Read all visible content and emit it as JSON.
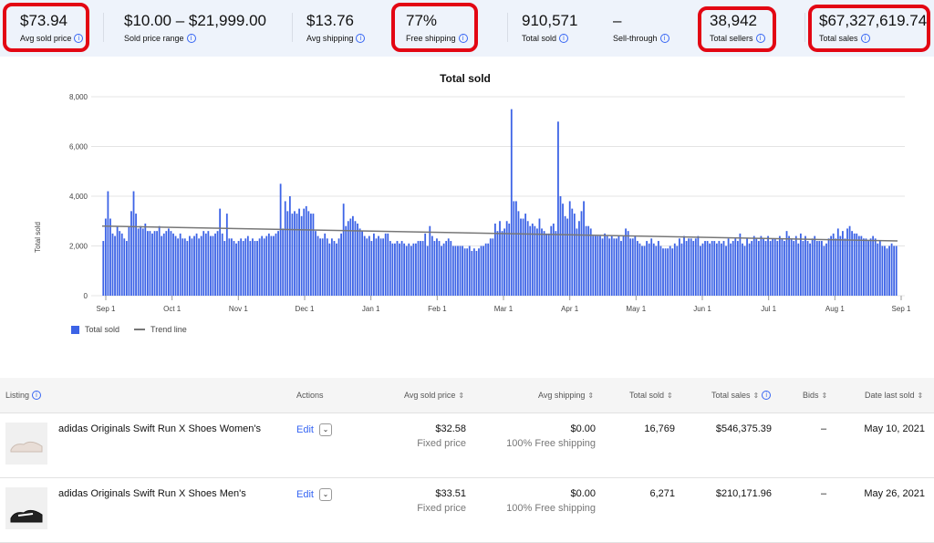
{
  "metrics": [
    {
      "value": "$73.94",
      "label": "Avg sold price",
      "highlight": true
    },
    {
      "value": "$10.00 – $21,999.00",
      "label": "Sold price range",
      "highlight": false
    },
    {
      "value": "$13.76",
      "label": "Avg shipping",
      "highlight": false
    },
    {
      "value": "77%",
      "label": "Free shipping",
      "highlight": true
    },
    {
      "value": "910,571",
      "label": "Total sold",
      "highlight": false
    },
    {
      "value": "–",
      "label": "Sell-through",
      "highlight": false
    },
    {
      "value": "38,942",
      "label": "Total sellers",
      "highlight": true
    },
    {
      "value": "$67,327,619.74",
      "label": "Total sales",
      "highlight": true
    }
  ],
  "chart_data": {
    "type": "bar",
    "title": "Total sold",
    "ylabel": "Total sold",
    "ylim": [
      0,
      8000
    ],
    "yticks": [
      "0",
      "2,000",
      "4,000",
      "6,000",
      "8,000"
    ],
    "xticks": [
      "Sep 1",
      "Oct 1",
      "Nov 1",
      "Dec 1",
      "Jan 1",
      "Feb 1",
      "Mar 1",
      "Apr 1",
      "May 1",
      "Jun 1",
      "Jul 1",
      "Aug 1",
      "Sep 1"
    ],
    "series": [
      {
        "name": "Total sold",
        "color": "#3c63e6"
      },
      {
        "name": "Trend line",
        "color": "#777777",
        "trend": [
          2800,
          2200
        ]
      }
    ],
    "grid": true,
    "legend": "bottom-left",
    "values": [
      2200,
      3100,
      4200,
      3100,
      2500,
      2400,
      2800,
      2600,
      2500,
      2300,
      2200,
      2800,
      3400,
      4200,
      3300,
      2700,
      2800,
      2700,
      2900,
      2600,
      2600,
      2500,
      2600,
      2600,
      2800,
      2400,
      2500,
      2600,
      2700,
      2600,
      2500,
      2400,
      2300,
      2500,
      2300,
      2300,
      2200,
      2400,
      2300,
      2400,
      2500,
      2300,
      2400,
      2600,
      2500,
      2600,
      2400,
      2400,
      2500,
      2600,
      3500,
      2500,
      2200,
      3300,
      2300,
      2300,
      2200,
      2100,
      2200,
      2300,
      2200,
      2300,
      2400,
      2200,
      2300,
      2200,
      2200,
      2300,
      2400,
      2300,
      2400,
      2500,
      2400,
      2400,
      2500,
      2600,
      4500,
      2700,
      3800,
      3400,
      4000,
      3300,
      3400,
      3300,
      3500,
      3200,
      3500,
      3600,
      3400,
      3300,
      3300,
      2600,
      2400,
      2300,
      2300,
      2500,
      2300,
      2100,
      2300,
      2200,
      2100,
      2300,
      2500,
      3700,
      2800,
      3000,
      3100,
      3200,
      3000,
      2900,
      2700,
      2600,
      2400,
      2300,
      2400,
      2200,
      2500,
      2300,
      2400,
      2300,
      2300,
      2500,
      2500,
      2200,
      2100,
      2100,
      2200,
      2100,
      2200,
      2100,
      2000,
      2100,
      2000,
      2100,
      2100,
      2200,
      2200,
      2200,
      2500,
      2000,
      2800,
      2400,
      2200,
      2300,
      2200,
      2000,
      2100,
      2200,
      2300,
      2200,
      2000,
      2000,
      2000,
      2000,
      2000,
      1900,
      1900,
      2000,
      1800,
      1900,
      1800,
      1900,
      2000,
      2000,
      2100,
      2100,
      2300,
      2300,
      2900,
      2600,
      3000,
      2600,
      2700,
      3000,
      2900,
      7500,
      3800,
      3800,
      3400,
      3100,
      3100,
      3300,
      3000,
      2800,
      2900,
      2800,
      2700,
      3100,
      2700,
      2600,
      2500,
      2500,
      2800,
      2900,
      2600,
      7000,
      4000,
      3700,
      3200,
      3100,
      3800,
      3500,
      3300,
      2700,
      3000,
      3400,
      3800,
      2800,
      2800,
      2700,
      2400,
      2400,
      2400,
      2400,
      2300,
      2500,
      2400,
      2300,
      2400,
      2300,
      2300,
      2400,
      2200,
      2400,
      2700,
      2600,
      2300,
      2300,
      2400,
      2200,
      2100,
      2000,
      2000,
      2200,
      2100,
      2300,
      2100,
      2000,
      2200,
      2000,
      1900,
      1900,
      1900,
      2000,
      1900,
      2100,
      2000,
      2300,
      2100,
      2400,
      2200,
      2300,
      2300,
      2200,
      2300,
      2400,
      2000,
      2100,
      2200,
      2200,
      2100,
      2200,
      2200,
      2100,
      2200,
      2100,
      2200,
      2000,
      2300,
      2100,
      2200,
      2300,
      2200,
      2500,
      2100,
      2000,
      2300,
      2100,
      2200,
      2400,
      2300,
      2200,
      2400,
      2300,
      2200,
      2400,
      2200,
      2300,
      2300,
      2200,
      2400,
      2300,
      2200,
      2600,
      2400,
      2300,
      2200,
      2400,
      2100,
      2500,
      2200,
      2400,
      2200,
      2100,
      2300,
      2400,
      2200,
      2200,
      2200,
      2000,
      2100,
      2300,
      2400,
      2500,
      2300,
      2700,
      2400,
      2600,
      2300,
      2700,
      2800,
      2600,
      2500,
      2500,
      2400,
      2400,
      2300,
      2300,
      2200,
      2300,
      2400,
      2300,
      2100,
      2200,
      2000,
      2000,
      1900,
      2000,
      2100,
      2000,
      2000
    ]
  },
  "table": {
    "headers": [
      "Listing",
      "Actions",
      "Avg sold price",
      "Avg shipping",
      "Total sold",
      "Total sales",
      "Bids",
      "Date last sold"
    ],
    "rows": [
      {
        "title": "adidas Originals Swift Run X Shoes Women's",
        "action": "Edit",
        "price": "$32.58",
        "price_type": "Fixed price",
        "shipping": "$0.00",
        "shipping_note": "100% Free shipping",
        "sold": "16,769",
        "sales": "$546,375.39",
        "bids": "–",
        "date": "May 10, 2021"
      },
      {
        "title": "adidas Originals Swift Run X Shoes Men's",
        "action": "Edit",
        "price": "$33.51",
        "price_type": "Fixed price",
        "shipping": "$0.00",
        "shipping_note": "100% Free shipping",
        "sold": "6,271",
        "sales": "$210,171.96",
        "bids": "–",
        "date": "May 26, 2021"
      }
    ]
  }
}
